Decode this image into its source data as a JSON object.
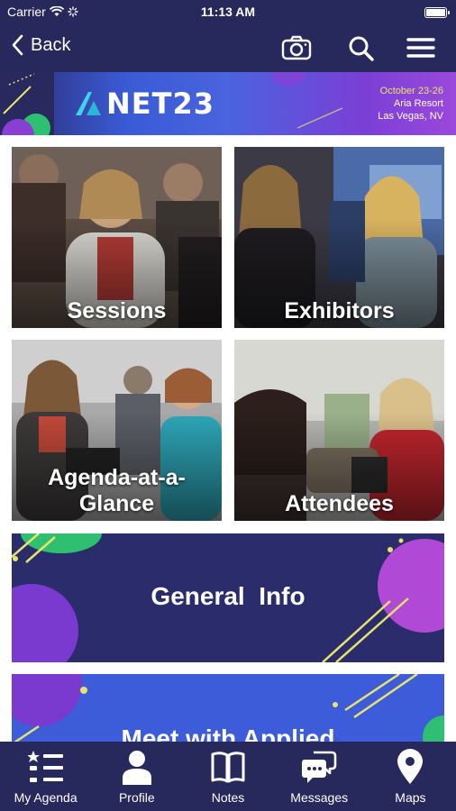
{
  "status_bar": {
    "carrier": "Carrier",
    "time": "11:13 AM",
    "battery_level": 1.0
  },
  "nav": {
    "back_label": "Back",
    "icons": [
      "camera-icon",
      "search-icon",
      "menu-icon"
    ]
  },
  "banner": {
    "logo_text": "NET23",
    "dates": "October 23-26",
    "venue": "Aria Resort",
    "city": "Las Vegas, NV"
  },
  "tiles": [
    {
      "label": "Sessions"
    },
    {
      "label": "Exhibitors"
    },
    {
      "label": "Agenda-at-a-\nGlance"
    },
    {
      "label": "Attendees"
    }
  ],
  "promos": {
    "general_info": "General  Info",
    "meet": "Meet with Applied"
  },
  "tab_bar": {
    "tabs": [
      {
        "label": "My Agenda",
        "icon": "list-icon"
      },
      {
        "label": "Profile",
        "icon": "person-icon"
      },
      {
        "label": "Notes",
        "icon": "book-icon"
      },
      {
        "label": "Messages",
        "icon": "chat-icon"
      },
      {
        "label": "Maps",
        "icon": "map-pin-icon"
      }
    ]
  },
  "colors": {
    "navy": "#27285c",
    "banner_blue": "#3a5bd6",
    "banner_purple": "#9a49db",
    "accent_yellow": "#e8e36a",
    "accent_green": "#2fbf71"
  }
}
